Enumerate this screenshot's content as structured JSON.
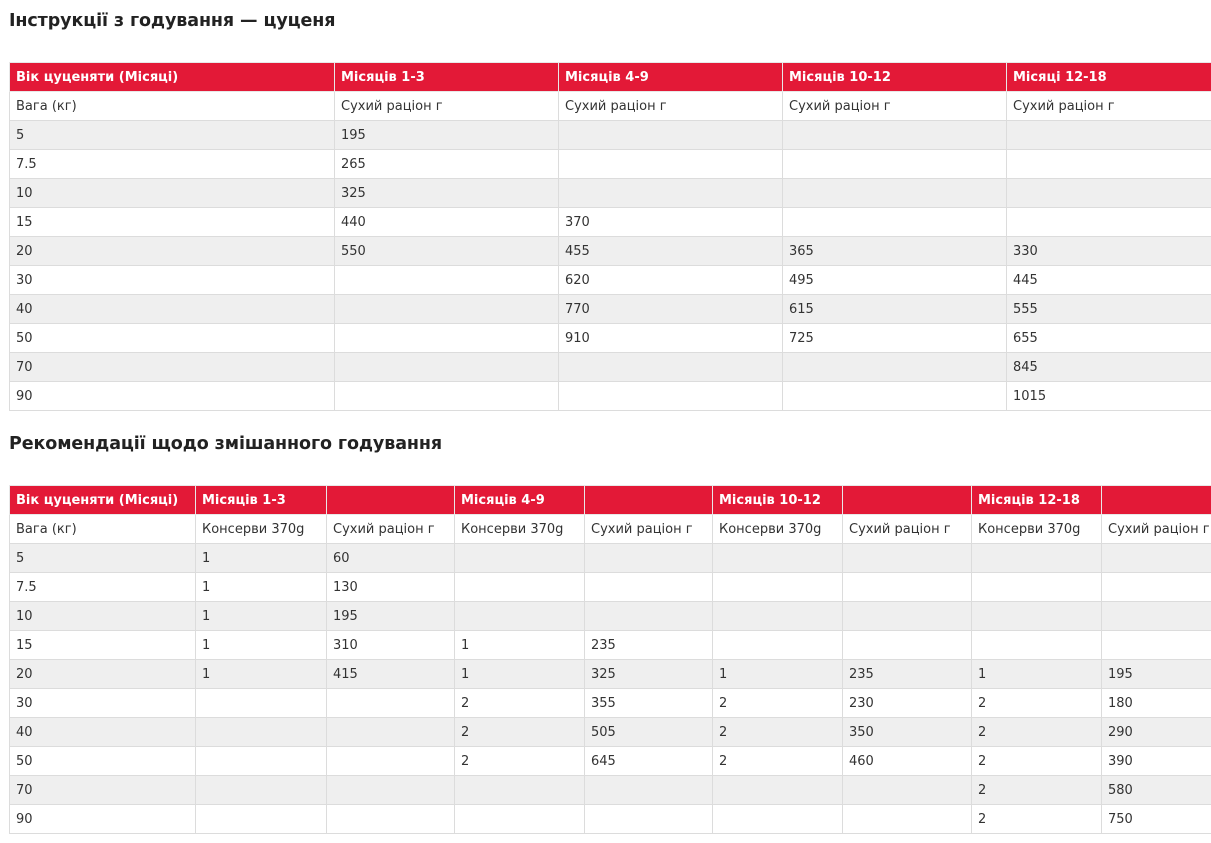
{
  "feeding_puppy": {
    "title": "Інструкції з годування — цуценя",
    "header": [
      "Вік цуценяти (Місяці)",
      "Місяців 1-3",
      "Місяців 4-9",
      "Місяців 10-12",
      "Місяці 12-18"
    ],
    "subheader": [
      "Вага (кг)",
      "Сухий раціон г",
      "Сухий раціон г",
      "Сухий раціон г",
      "Сухий раціон г"
    ],
    "rows": [
      [
        "5",
        "195",
        "",
        "",
        ""
      ],
      [
        "7.5",
        "265",
        "",
        "",
        ""
      ],
      [
        "10",
        "325",
        "",
        "",
        ""
      ],
      [
        "15",
        "440",
        "370",
        "",
        ""
      ],
      [
        "20",
        "550",
        "455",
        "365",
        "330"
      ],
      [
        "30",
        "",
        "620",
        "495",
        "445"
      ],
      [
        "40",
        "",
        "770",
        "615",
        "555"
      ],
      [
        "50",
        "",
        "910",
        "725",
        "655"
      ],
      [
        "70",
        "",
        "",
        "",
        "845"
      ],
      [
        "90",
        "",
        "",
        "",
        "1015"
      ]
    ]
  },
  "mixed_feeding": {
    "title": "Рекомендації щодо змішанного годування",
    "header": [
      "Вік цуценяти (Місяці)",
      "Місяців 1-3",
      "",
      "Місяців 4-9",
      "",
      "Місяців 10-12",
      "",
      "Місяців 12-18",
      ""
    ],
    "subheader": [
      "Вага (кг)",
      "Консерви 370g",
      "Сухий раціон г",
      "Консерви 370g",
      "Сухий раціон г",
      "Консерви 370g",
      "Сухий раціон г",
      "Консерви 370g",
      "Сухий раціон г"
    ],
    "rows": [
      [
        "5",
        "1",
        "60",
        "",
        "",
        "",
        "",
        "",
        ""
      ],
      [
        "7.5",
        "1",
        "130",
        "",
        "",
        "",
        "",
        "",
        ""
      ],
      [
        "10",
        "1",
        "195",
        "",
        "",
        "",
        "",
        "",
        ""
      ],
      [
        "15",
        "1",
        "310",
        "1",
        "235",
        "",
        "",
        "",
        ""
      ],
      [
        "20",
        "1",
        "415",
        "1",
        "325",
        "1",
        "235",
        "1",
        "195"
      ],
      [
        "30",
        "",
        "",
        "2",
        "355",
        "2",
        "230",
        "2",
        "180"
      ],
      [
        "40",
        "",
        "",
        "2",
        "505",
        "2",
        "350",
        "2",
        "290"
      ],
      [
        "50",
        "",
        "",
        "2",
        "645",
        "2",
        "460",
        "2",
        "390"
      ],
      [
        "70",
        "",
        "",
        "",
        "",
        "",
        "",
        "2",
        "580"
      ],
      [
        "90",
        "",
        "",
        "",
        "",
        "",
        "",
        "2",
        "750"
      ]
    ]
  },
  "colors": {
    "header_bg": "#e31937",
    "header_text": "#ffffff",
    "row_alt_bg": "#efefef",
    "border": "#dcdcdc"
  }
}
